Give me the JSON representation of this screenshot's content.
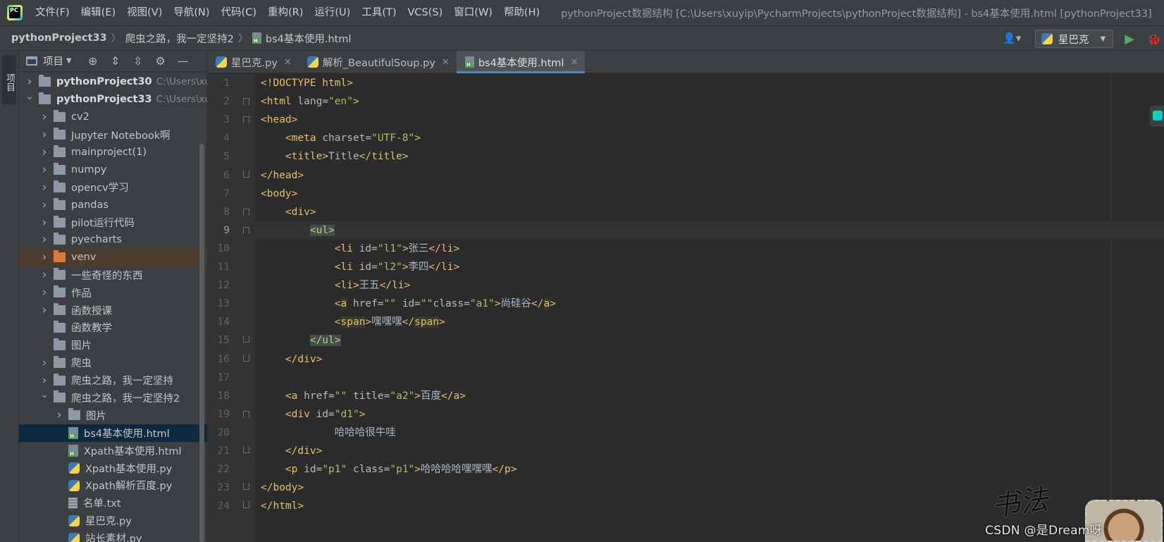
{
  "menubar": {
    "items": [
      "文件(F)",
      "编辑(E)",
      "视图(V)",
      "导航(N)",
      "代码(C)",
      "重构(R)",
      "运行(U)",
      "工具(T)",
      "VCS(S)",
      "窗口(W)",
      "帮助(H)"
    ],
    "window_title": "pythonProject数据结构 [C:\\Users\\xuyip\\PycharmProjects\\pythonProject数据结构] - bs4基本使用.html [pythonProject33]"
  },
  "navbar": {
    "breadcrumbs": [
      "pythonProject33",
      "爬虫之路，我一定坚持2",
      "bs4基本使用.html"
    ],
    "run_config": "星巴克"
  },
  "left_stripe": {
    "project_label": "项目"
  },
  "project_panel": {
    "view_label": "项目",
    "tree": [
      {
        "label": "pythonProject30",
        "path": "C:\\Users\\xu",
        "type": "folder",
        "depth": 0,
        "expanded": false,
        "bold": true
      },
      {
        "label": "pythonProject33",
        "path": "C:\\Users\\xu",
        "type": "folder",
        "depth": 0,
        "expanded": true,
        "bold": true
      },
      {
        "label": "cv2",
        "type": "folder",
        "depth": 1,
        "expanded": false
      },
      {
        "label": "Jupyter Notebook啊",
        "type": "folder",
        "depth": 1,
        "expanded": false
      },
      {
        "label": "mainproject(1)",
        "type": "folder",
        "depth": 1,
        "expanded": false
      },
      {
        "label": "numpy",
        "type": "folder",
        "depth": 1,
        "expanded": false
      },
      {
        "label": "opencv学习",
        "type": "folder",
        "depth": 1,
        "expanded": false
      },
      {
        "label": "pandas",
        "type": "folder",
        "depth": 1,
        "expanded": false
      },
      {
        "label": "pilot运行代码",
        "type": "folder",
        "depth": 1,
        "expanded": false
      },
      {
        "label": "pyecharts",
        "type": "folder",
        "depth": 1,
        "expanded": false
      },
      {
        "label": "venv",
        "type": "folder-orange",
        "depth": 1,
        "expanded": false
      },
      {
        "label": "一些奇怪的东西",
        "type": "folder",
        "depth": 1,
        "expanded": false
      },
      {
        "label": "作品",
        "type": "folder",
        "depth": 1,
        "expanded": false
      },
      {
        "label": "函数授课",
        "type": "folder",
        "depth": 1,
        "expanded": false
      },
      {
        "label": "函数教学",
        "type": "folder",
        "depth": 1,
        "expanded": null
      },
      {
        "label": "图片",
        "type": "folder",
        "depth": 1,
        "expanded": null
      },
      {
        "label": "爬虫",
        "type": "folder",
        "depth": 1,
        "expanded": false
      },
      {
        "label": "爬虫之路，我一定坚持",
        "type": "folder",
        "depth": 1,
        "expanded": false
      },
      {
        "label": "爬虫之路，我一定坚持2",
        "type": "folder",
        "depth": 1,
        "expanded": true
      },
      {
        "label": "图片",
        "type": "folder",
        "depth": 2,
        "expanded": false
      },
      {
        "label": "bs4基本使用.html",
        "type": "html",
        "depth": 2,
        "selected": true
      },
      {
        "label": "Xpath基本使用.html",
        "type": "html",
        "depth": 2
      },
      {
        "label": "Xpath基本使用.py",
        "type": "py",
        "depth": 2
      },
      {
        "label": "Xpath解析百度.py",
        "type": "py",
        "depth": 2
      },
      {
        "label": "名单.txt",
        "type": "txt",
        "depth": 2
      },
      {
        "label": "星巴克.py",
        "type": "py",
        "depth": 2
      },
      {
        "label": "站长素材.py",
        "type": "py",
        "depth": 2
      }
    ]
  },
  "tabs": [
    {
      "label": "星巴克.py",
      "icon": "python-file-icon",
      "active": false
    },
    {
      "label": "解析_BeautifulSoup.py",
      "icon": "python-file-icon",
      "active": false
    },
    {
      "label": "bs4基本使用.html",
      "icon": "html-file-icon",
      "active": true
    }
  ],
  "editor": {
    "current_line": 9,
    "lines": [
      {
        "n": "1",
        "tokens": [
          [
            "t",
            "<!DOCTYPE html>"
          ]
        ]
      },
      {
        "n": "2",
        "tokens": [
          [
            "t",
            "<html "
          ],
          [
            "a",
            "lang="
          ],
          [
            "s",
            "\"en\""
          ],
          [
            "t",
            ">"
          ]
        ]
      },
      {
        "n": "3",
        "tokens": [
          [
            "t",
            "<head>"
          ]
        ]
      },
      {
        "n": "4",
        "tokens": [
          [
            "x",
            "    "
          ],
          [
            "t",
            "<meta "
          ],
          [
            "a",
            "charset="
          ],
          [
            "s",
            "\"UTF-8\""
          ],
          [
            "t",
            ">"
          ]
        ]
      },
      {
        "n": "5",
        "tokens": [
          [
            "x",
            "    "
          ],
          [
            "t",
            "<title>"
          ],
          [
            "x",
            "Title"
          ],
          [
            "t",
            "</title>"
          ]
        ]
      },
      {
        "n": "6",
        "tokens": [
          [
            "t",
            "</head>"
          ]
        ]
      },
      {
        "n": "7",
        "tokens": [
          [
            "t",
            "<body>"
          ]
        ]
      },
      {
        "n": "8",
        "tokens": [
          [
            "x",
            "    "
          ],
          [
            "t",
            "<div>"
          ]
        ]
      },
      {
        "n": "9",
        "tokens": [
          [
            "x",
            "        "
          ],
          [
            "th",
            "<ul>"
          ]
        ]
      },
      {
        "n": "10",
        "tokens": [
          [
            "x",
            "            "
          ],
          [
            "t",
            "<li "
          ],
          [
            "a",
            "id="
          ],
          [
            "s",
            "\"l1\""
          ],
          [
            "t",
            ">"
          ],
          [
            "x",
            "张三"
          ],
          [
            "t",
            "</li>"
          ]
        ]
      },
      {
        "n": "11",
        "tokens": [
          [
            "x",
            "            "
          ],
          [
            "t",
            "<li "
          ],
          [
            "a",
            "id="
          ],
          [
            "s",
            "\"l2\""
          ],
          [
            "t",
            ">"
          ],
          [
            "x",
            "李四"
          ],
          [
            "t",
            "</li>"
          ]
        ]
      },
      {
        "n": "12",
        "tokens": [
          [
            "x",
            "            "
          ],
          [
            "t",
            "<li>"
          ],
          [
            "x",
            "王五"
          ],
          [
            "t",
            "</li>"
          ]
        ]
      },
      {
        "n": "13",
        "tokens": [
          [
            "x",
            "            "
          ],
          [
            "t",
            "<"
          ],
          [
            "tb",
            "a"
          ],
          [
            "a",
            " href="
          ],
          [
            "s",
            "\"\""
          ],
          [
            "a",
            " id="
          ],
          [
            "s",
            "\"\""
          ],
          [
            "a",
            "class="
          ],
          [
            "s",
            "\"a1\""
          ],
          [
            "t",
            ">"
          ],
          [
            "x",
            "尚硅谷"
          ],
          [
            "t",
            "</"
          ],
          [
            "tb",
            "a"
          ],
          [
            "t",
            ">"
          ]
        ]
      },
      {
        "n": "14",
        "tokens": [
          [
            "x",
            "            "
          ],
          [
            "t",
            "<"
          ],
          [
            "tb",
            "span"
          ],
          [
            "t",
            ">"
          ],
          [
            "x",
            "嘿嘿嘿"
          ],
          [
            "t",
            "</"
          ],
          [
            "tb",
            "span"
          ],
          [
            "t",
            ">"
          ]
        ]
      },
      {
        "n": "15",
        "tokens": [
          [
            "x",
            "        "
          ],
          [
            "th",
            "</ul>"
          ]
        ]
      },
      {
        "n": "16",
        "tokens": [
          [
            "x",
            "    "
          ],
          [
            "t",
            "</div>"
          ]
        ]
      },
      {
        "n": "17",
        "tokens": []
      },
      {
        "n": "18",
        "tokens": [
          [
            "x",
            "    "
          ],
          [
            "t",
            "<a "
          ],
          [
            "a",
            "href="
          ],
          [
            "s",
            "\"\""
          ],
          [
            "a",
            " title="
          ],
          [
            "s",
            "\"a2\""
          ],
          [
            "t",
            ">"
          ],
          [
            "x",
            "百度"
          ],
          [
            "t",
            "</a>"
          ]
        ]
      },
      {
        "n": "19",
        "tokens": [
          [
            "x",
            "    "
          ],
          [
            "t",
            "<div "
          ],
          [
            "a",
            "id="
          ],
          [
            "s",
            "\"d1\""
          ],
          [
            "t",
            ">"
          ]
        ]
      },
      {
        "n": "20",
        "tokens": [
          [
            "x",
            "            哈哈哈很牛哇"
          ]
        ]
      },
      {
        "n": "21",
        "tokens": [
          [
            "x",
            "    "
          ],
          [
            "t",
            "</div>"
          ]
        ]
      },
      {
        "n": "22",
        "tokens": [
          [
            "x",
            "    "
          ],
          [
            "t",
            "<p "
          ],
          [
            "a",
            "id="
          ],
          [
            "s",
            "\"p1\""
          ],
          [
            "a",
            " class="
          ],
          [
            "s",
            "\"p1\""
          ],
          [
            "t",
            ">"
          ],
          [
            "x",
            "哈哈哈哈嘿嘿嘿"
          ],
          [
            "t",
            "</p>"
          ]
        ]
      },
      {
        "n": "23",
        "tokens": [
          [
            "t",
            "</body>"
          ]
        ]
      },
      {
        "n": "24",
        "tokens": [
          [
            "t",
            "</html>"
          ]
        ]
      }
    ],
    "fold_open": [
      "2",
      "3",
      "8",
      "9",
      "19"
    ],
    "fold_close": [
      "6",
      "15",
      "16",
      "21",
      "23",
      "24"
    ]
  },
  "watermark": "CSDN @是Dream呀",
  "colors": {
    "accent": "#4a88c7",
    "tag": "#e8bf6a",
    "string": "#a5c261",
    "attr": "#bababa",
    "text": "#a9b7c6"
  }
}
